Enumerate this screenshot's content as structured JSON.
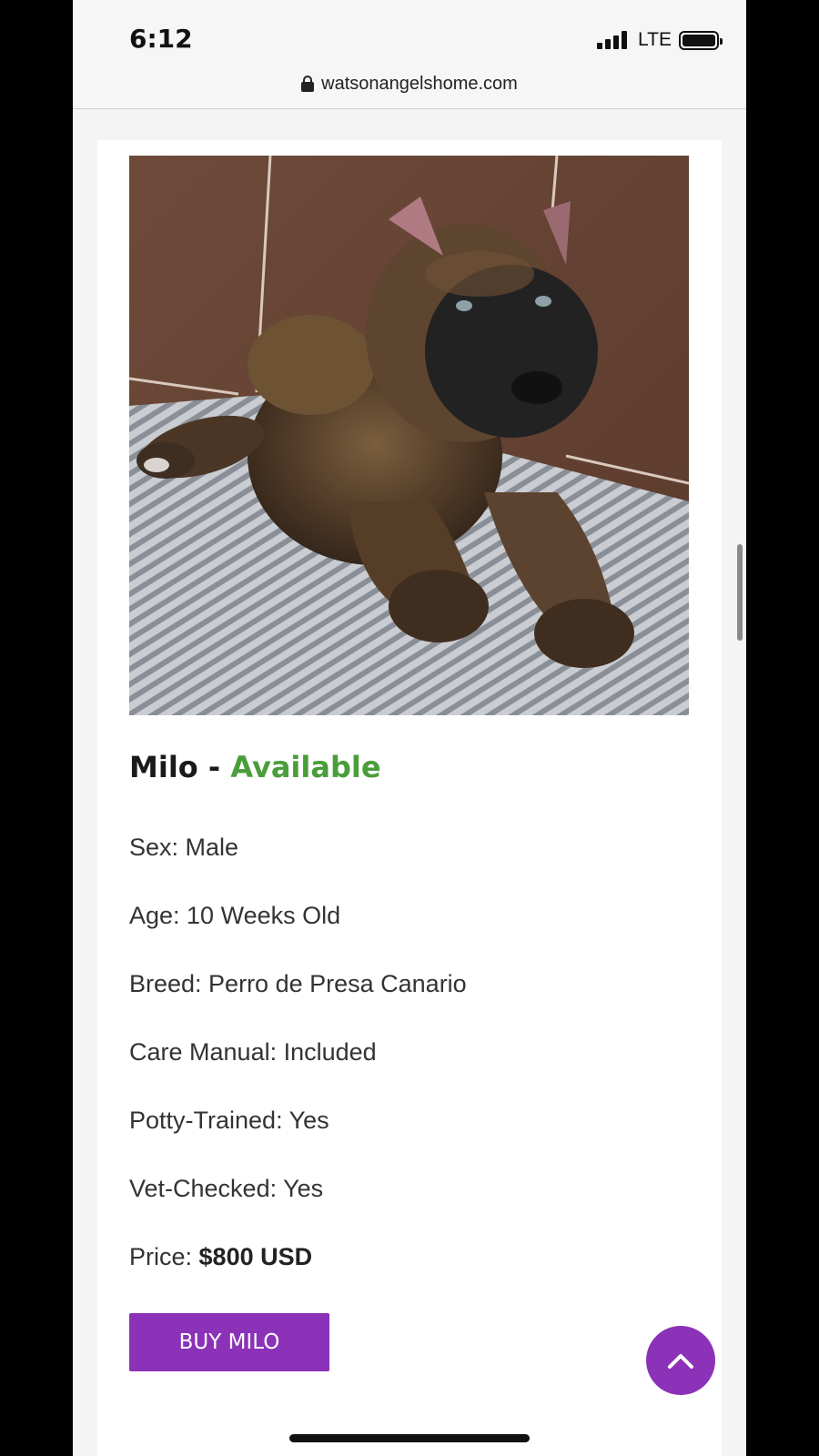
{
  "status_bar": {
    "time": "6:12",
    "network": "LTE"
  },
  "browser": {
    "url": "watsonangelshome.com"
  },
  "puppy": {
    "name_prefix": "Milo - ",
    "status": "Available",
    "status_color": "#4a9e3a",
    "details": [
      "Sex: Male",
      "Age: 10 Weeks Old",
      "Breed: Perro de Presa Canario",
      "Care Manual: Included",
      "Potty-Trained: Yes",
      "Vet-Checked: Yes"
    ],
    "price_label": "Price: ",
    "price_value": "$800 USD",
    "buy_label": "BUY MILO"
  },
  "colors": {
    "accent": "#8b32b8"
  },
  "icons": {
    "lock": "lock-icon",
    "scroll_top": "chevron-up-icon"
  }
}
